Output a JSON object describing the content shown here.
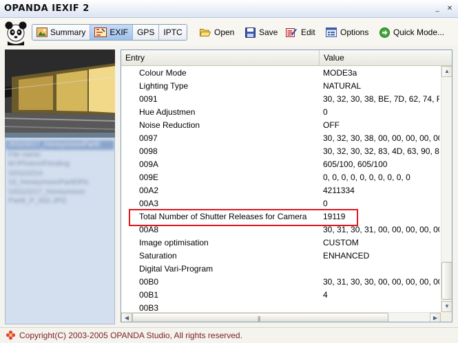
{
  "app": {
    "title": "OPANDA IEXIF 2"
  },
  "titlebar": {
    "minimize": "_",
    "close": "✕"
  },
  "toolbar": {
    "tabs": [
      {
        "label": "Summary",
        "icon": "summary-icon",
        "active": false
      },
      {
        "label": "EXIF",
        "icon": "exif-icon",
        "active": true
      },
      {
        "label": "GPS",
        "icon": "",
        "active": false
      },
      {
        "label": "IPTC",
        "icon": "",
        "active": false
      }
    ],
    "open": "Open",
    "save": "Save",
    "edit": "Edit",
    "options": "Options",
    "quick_mode": "Quick Mode..."
  },
  "table": {
    "headers": {
      "entry": "Entry",
      "value": "Value"
    },
    "rows": [
      {
        "entry": "Colour Mode",
        "value": "MODE3a"
      },
      {
        "entry": "Lighting Type",
        "value": "NATURAL"
      },
      {
        "entry": "0091",
        "value": "30, 32, 30, 38, BE, 7D, 62, 74, F"
      },
      {
        "entry": "Hue Adjustmen",
        "value": "0"
      },
      {
        "entry": "Noise Reduction",
        "value": "OFF"
      },
      {
        "entry": "0097",
        "value": "30, 32, 30, 38, 00, 00, 00, 00, 00"
      },
      {
        "entry": "0098",
        "value": "30, 32, 30, 32, 83, 4D, 63, 90, 8"
      },
      {
        "entry": "009A",
        "value": "605/100, 605/100"
      },
      {
        "entry": "009E",
        "value": "0, 0, 0, 0, 0, 0, 0, 0, 0, 0"
      },
      {
        "entry": "00A2",
        "value": "4211334"
      },
      {
        "entry": "00A3",
        "value": "0"
      },
      {
        "entry": "Total Number of Shutter Releases for Camera",
        "value": "19119"
      },
      {
        "entry": "00A8",
        "value": "30, 31, 30, 31, 00, 00, 00, 00, 00"
      },
      {
        "entry": "Image optimisation",
        "value": "CUSTOM"
      },
      {
        "entry": "Saturation",
        "value": "ENHANCED"
      },
      {
        "entry": "Digital Vari-Program",
        "value": ""
      },
      {
        "entry": "00B0",
        "value": "30, 31, 30, 30, 00, 00, 00, 00, 00"
      },
      {
        "entry": "00B1",
        "value": "4"
      },
      {
        "entry": "00B3",
        "value": ""
      }
    ],
    "highlighted_row": 11,
    "highlight_color": "#e0161b"
  },
  "left_panel": {
    "file_info_lines": [
      "20110217_HoneymoonPart0",
      "File name:",
      "M:\\Photos\\Pending",
      "\\20110214-",
      "15_HoneymoonPart6\\Pic",
      "\\20110217_Honeymoon",
      "Part6_P_002.JPG"
    ]
  },
  "status": {
    "text": "Copyright(C) 2003-2005 OPANDA Studio, All rights reserved."
  }
}
